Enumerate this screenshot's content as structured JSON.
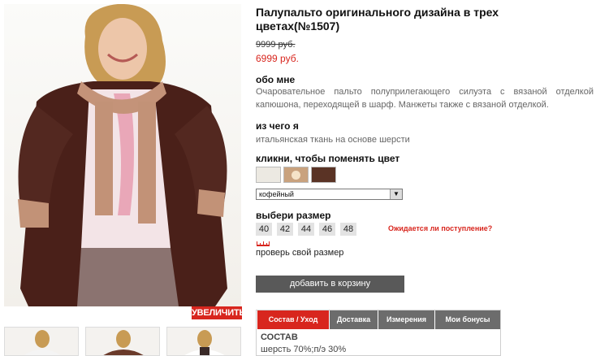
{
  "product": {
    "title": "Палупальто оригинального дизайна в трех цветах(№1507)",
    "old_price": "9999 руб.",
    "new_price": "6999 руб.",
    "zoom_label": "УВЕЛИЧИТЬ"
  },
  "about": {
    "heading": "обо мне",
    "text": "Очаровательное пальто полуприлегающего силуэта с вязаной отделкой капюшона, переходящей в шарф. Манжеты также с вязаной отделкой."
  },
  "material": {
    "heading": "из чего я",
    "text": "итальянская ткань на основе шерсти"
  },
  "color": {
    "heading": "кликни, чтобы поменять цвет",
    "selected": "кофейный",
    "swatches": [
      "#ece9e2",
      "#c9a27e",
      "#5a3325"
    ]
  },
  "size": {
    "heading": "выбери размер",
    "options": [
      "40",
      "42",
      "44",
      "46",
      "48"
    ],
    "notify": "Ожидается ли поступление?",
    "check": "проверь свой размер"
  },
  "cart": {
    "label": "добавить в корзину"
  },
  "tabs": {
    "items": [
      "Состав / Уход",
      "Доставка",
      "Измерения",
      "Мои бонусы"
    ],
    "active": 0,
    "content_heading": "СОСТАВ",
    "content_text": "шерсть 70%;п/э 30%"
  },
  "colors": {
    "accent": "#d8261e",
    "button": "#595959",
    "tab": "#6c6c6c"
  }
}
